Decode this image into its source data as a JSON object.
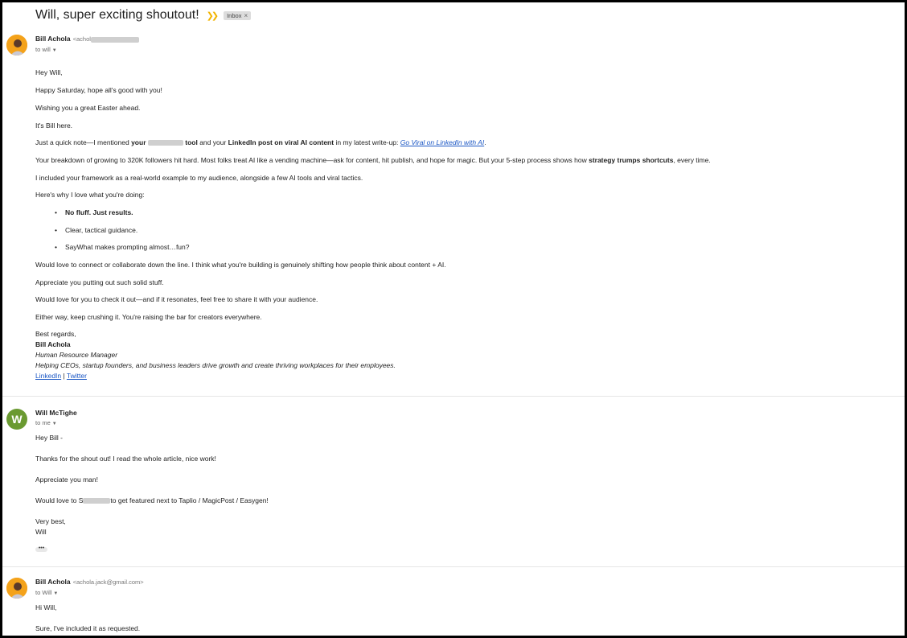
{
  "subject": "Will, super exciting shoutout!",
  "label": "Inbox",
  "label_close": "×",
  "messages": [
    {
      "sender": "Bill Achola",
      "email": "<achol",
      "to": "to will",
      "lines": {
        "greeting": "Hey Will,",
        "l1": "Happy Saturday, hope all's good with you!",
        "l2": "Wishing you a great Easter ahead.",
        "l3": "It's Bill here.",
        "l4_a": "Just a quick note—I mentioned ",
        "l4_b": "your",
        "l4_c": "tool",
        "l4_d": " and your ",
        "l4_e": "LinkedIn post on viral AI content",
        "l4_f": " in my latest write-up: ",
        "l4_link": "Go Viral on LinkedIn with AI",
        "l4_g": ".",
        "l5_a": "Your breakdown of growing to 320K followers hit hard. Most folks treat AI like a vending machine—ask for content, hit publish, and hope for magic. But your 5-step process shows how ",
        "l5_b": "strategy trumps shortcuts",
        "l5_c": ", every time.",
        "l6": "I included your framework as a real-world example to my audience, alongside a few AI tools and viral tactics.",
        "l7": "Here's why I love what you're doing:",
        "b1": "No fluff. Just results.",
        "b2": "Clear, tactical guidance.",
        "b3": "SayWhat makes prompting almost…fun?",
        "l8": "Would love to connect or collaborate down the line. I think what you're building is genuinely shifting how people think about content + AI.",
        "l9": "Appreciate you putting out such solid stuff.",
        "l10": "Would love for you to check it out—and if it resonates, feel free to share it with your audience.",
        "l11": "Either way, keep crushing it. You're raising the bar for creators everywhere.",
        "sig1": "Best regards,",
        "sig2": "Bill Achola",
        "sig3": "Human Resource Manager",
        "sig4": "Helping CEOs, startup founders, and business leaders drive growth and create thriving workplaces for their employees.",
        "sig_link1": "LinkedIn",
        "sig_sep": " | ",
        "sig_link2": "Twitter"
      }
    },
    {
      "sender": "Will McTighe",
      "avatar_letter": "W",
      "to": "to me",
      "lines": {
        "l1": "Hey Bill -",
        "l2": "Thanks for the shout out! I read the whole article, nice work!",
        "l3": "Appreciate you man!",
        "l4_a": "Would love to ",
        "l4_b": "S",
        "l4_c": "to get featured next to Taplio / MagicPost / Easygen!",
        "l5": "Very best,",
        "l6": "Will",
        "ellipsis": "•••"
      }
    },
    {
      "sender": "Bill Achola",
      "email": "<achola.jack@gmail.com>",
      "to": "to Will",
      "lines": {
        "l1": "Hi Will,",
        "l2": "Sure, I've included it as requested."
      }
    }
  ],
  "colors": {
    "link": "#1a56c4",
    "important": "#f2b400",
    "avatar_w": "#6a9a31",
    "avatar_photo": "#f4a21a"
  },
  "icons": [
    "importance-marker-icon",
    "chevron-down-icon",
    "avatar-photo-icon"
  ]
}
